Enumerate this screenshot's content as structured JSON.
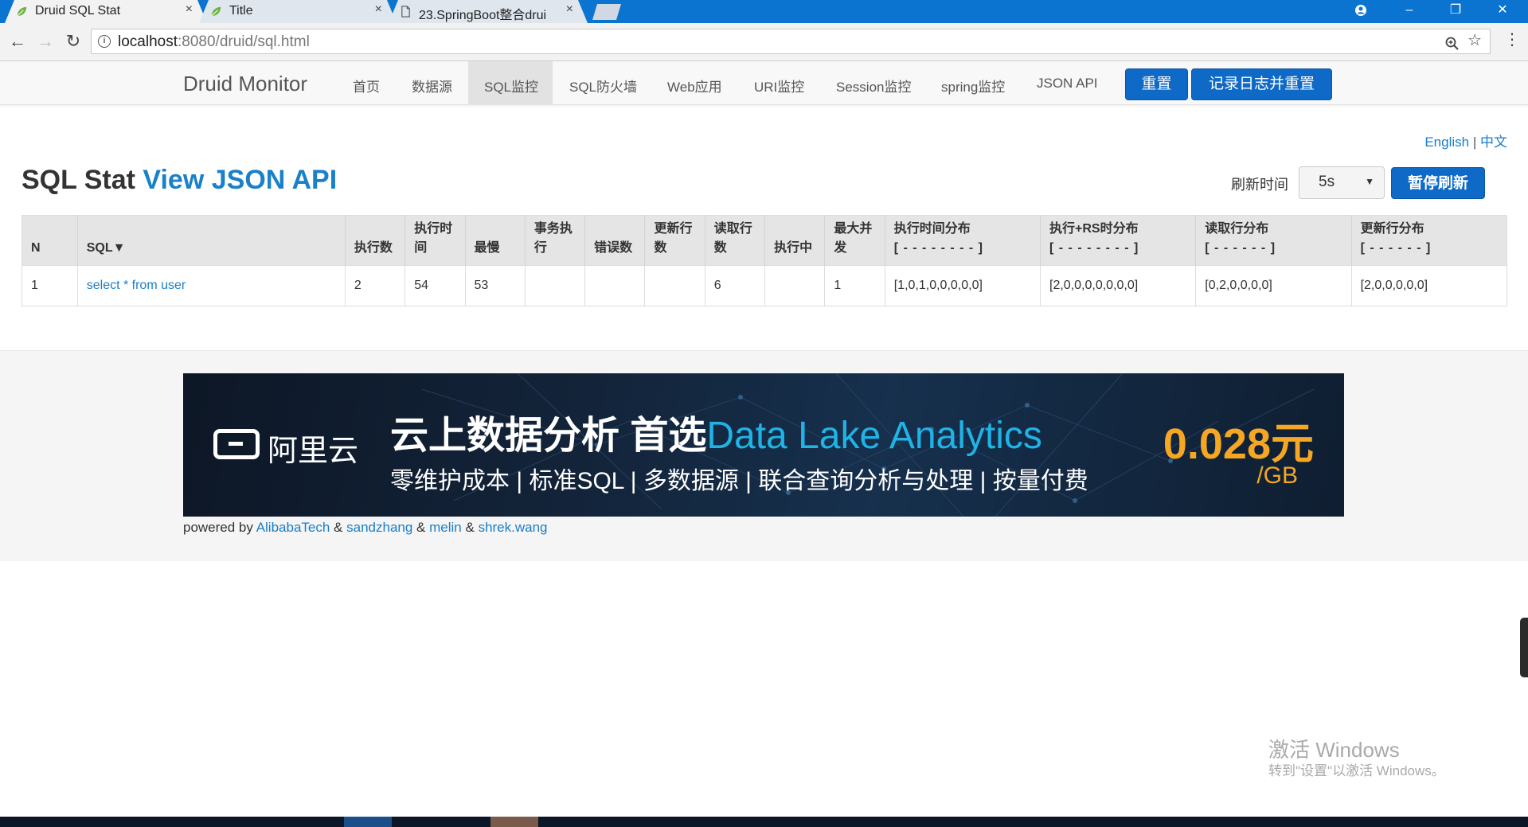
{
  "browser": {
    "tabs": [
      {
        "title": "Druid SQL Stat",
        "active": true,
        "icon": "leaf-icon"
      },
      {
        "title": "Title",
        "active": false,
        "icon": "leaf-icon"
      },
      {
        "title": "23.SpringBoot整合drui",
        "active": false,
        "icon": "document-icon"
      }
    ],
    "url_host": "localhost",
    "url_path": ":8080/druid/sql.html"
  },
  "navbar": {
    "brand": "Druid Monitor",
    "links": [
      "首页",
      "数据源",
      "SQL监控",
      "SQL防火墙",
      "Web应用",
      "URI监控",
      "Session监控",
      "spring监控",
      "JSON API"
    ],
    "active": "SQL监控",
    "reset_label": "重置",
    "log_reset_label": "记录日志并重置"
  },
  "lang": {
    "english": "English",
    "sep": "|",
    "chinese": "中文"
  },
  "page": {
    "title": "SQL Stat",
    "json_link": "View JSON API",
    "refresh_label": "刷新时间",
    "refresh_value": "5s",
    "pause_label": "暂停刷新"
  },
  "table": {
    "headers": [
      {
        "label": "N",
        "sub": ""
      },
      {
        "label": "SQL▼",
        "sub": ""
      },
      {
        "label": "执行数",
        "sub": ""
      },
      {
        "label": "执行时间",
        "sub": ""
      },
      {
        "label": "最慢",
        "sub": ""
      },
      {
        "label": "事务执行",
        "sub": ""
      },
      {
        "label": "错误数",
        "sub": ""
      },
      {
        "label": "更新行数",
        "sub": ""
      },
      {
        "label": "读取行数",
        "sub": ""
      },
      {
        "label": "执行中",
        "sub": ""
      },
      {
        "label": "最大并发",
        "sub": ""
      },
      {
        "label": "执行时间分布",
        "sub": "[ - - - - - - - - ]"
      },
      {
        "label": "执行+RS时分布",
        "sub": "[ - - - - - - - - ]"
      },
      {
        "label": "读取行分布",
        "sub": "[ - - - - - - ]"
      },
      {
        "label": "更新行分布",
        "sub": "[ - - - - - - ]"
      }
    ],
    "rows": [
      [
        "1",
        "select * from user",
        "2",
        "54",
        "53",
        "",
        "",
        "",
        "6",
        "",
        "1",
        "[1,0,1,0,0,0,0,0]",
        "[2,0,0,0,0,0,0,0]",
        "[0,2,0,0,0,0]",
        "[2,0,0,0,0,0]"
      ]
    ]
  },
  "banner": {
    "logo_text": "阿里云",
    "headline_cn": "云上数据分析 首选",
    "headline_en": "Data Lake Analytics",
    "subline": "零维护成本 | 标准SQL | 多数据源 | 联合查询分析与处理 | 按量付费",
    "price": "0.028元",
    "unit": "/GB"
  },
  "footer": {
    "prefix": "powered by",
    "links": [
      "AlibabaTech",
      "sandzhang",
      "melin",
      "shrek.wang"
    ],
    "amp": "&"
  },
  "watermark": {
    "line1": "激活 Windows",
    "line2": "转到\"设置\"以激活 Windows。"
  },
  "colors": {
    "tabstrip": "#0a74d0",
    "accent_button": "#0e6ac6",
    "link": "#1a80c9",
    "banner_highlight": "#1fb3e6",
    "price": "#f5a623"
  }
}
